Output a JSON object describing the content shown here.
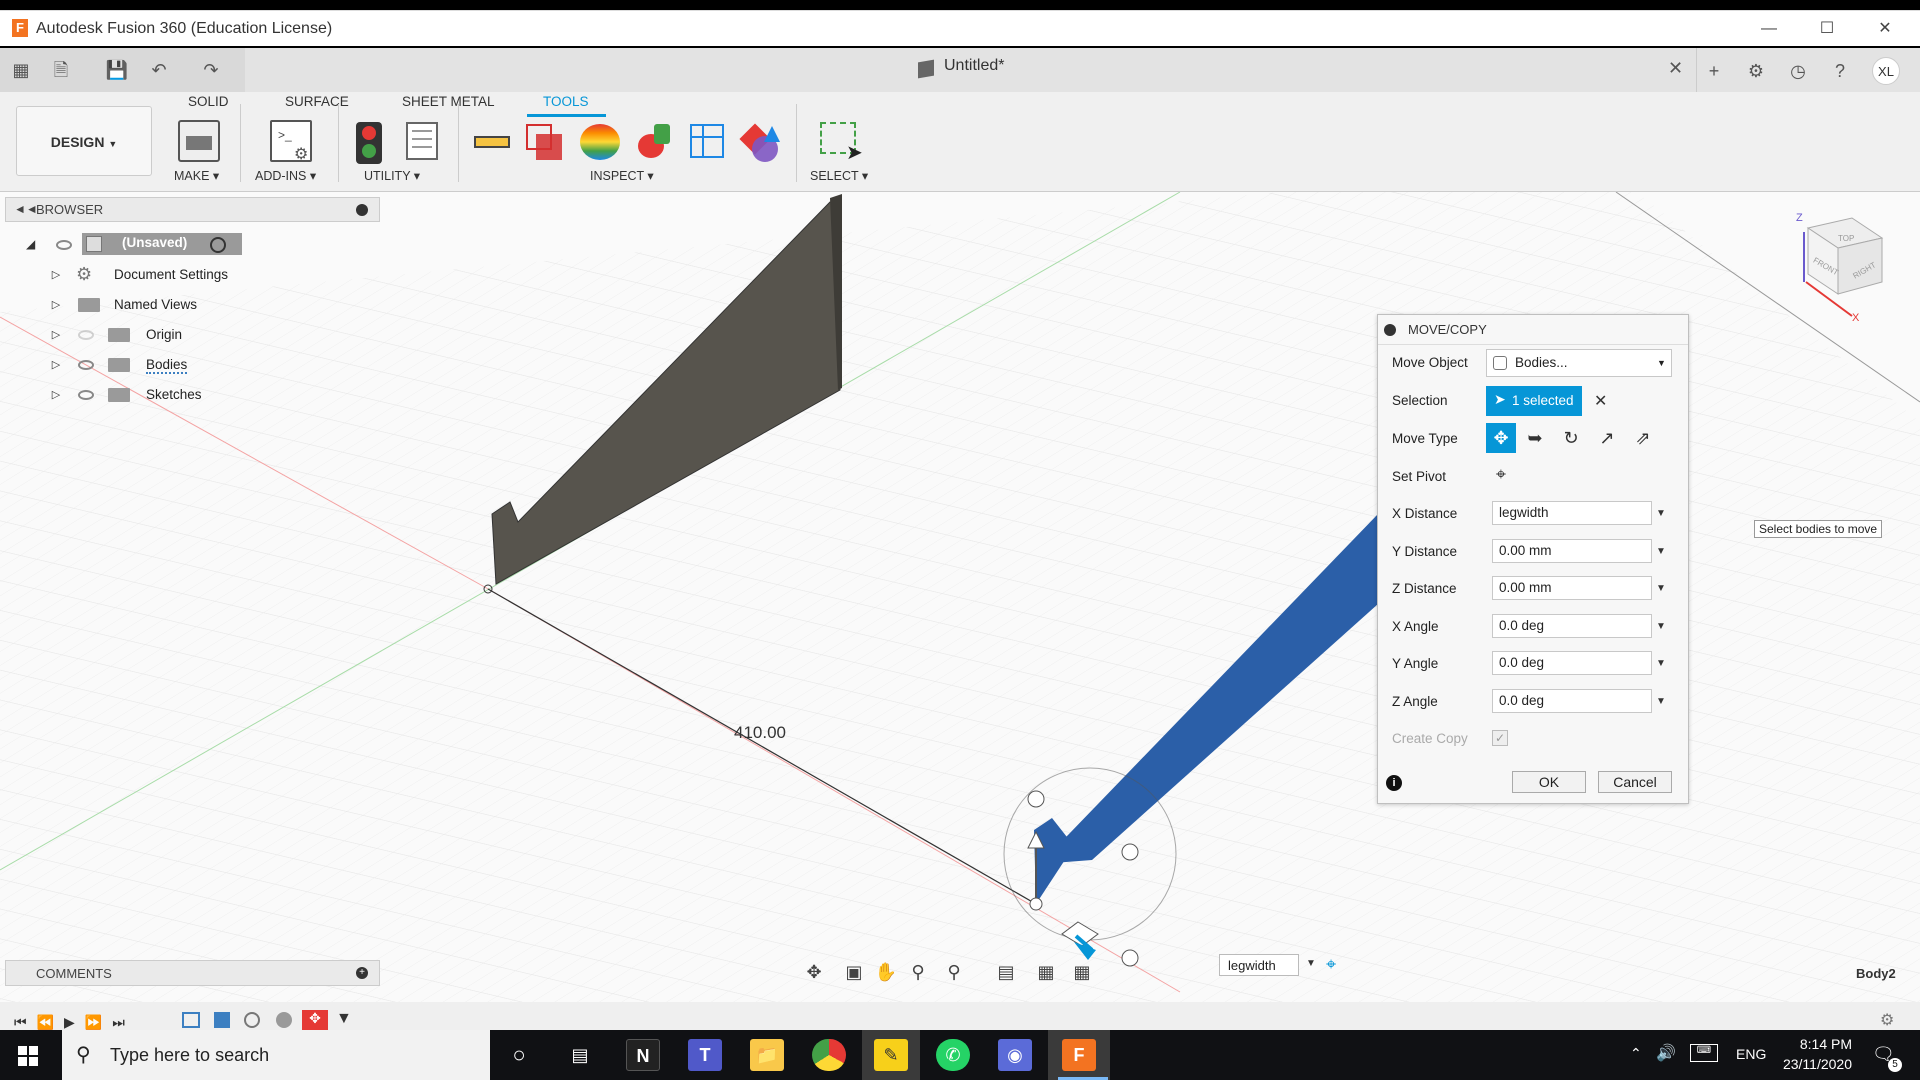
{
  "window": {
    "title": "Autodesk Fusion 360 (Education License)",
    "document_title": "Untitled*",
    "user_initials": "XL"
  },
  "ribbon": {
    "tabs": [
      "SOLID",
      "SURFACE",
      "SHEET METAL",
      "TOOLS"
    ],
    "active_tab": "TOOLS",
    "workspace": "DESIGN",
    "groups": {
      "make": "MAKE",
      "addins": "ADD-INS",
      "utility": "UTILITY",
      "inspect": "INSPECT",
      "select": "SELECT"
    }
  },
  "browser": {
    "title": "BROWSER",
    "root": "(Unsaved)",
    "items": [
      "Document Settings",
      "Named Views",
      "Origin",
      "Bodies",
      "Sketches"
    ]
  },
  "viewport": {
    "dimension": "410.00",
    "tooltip": "Select bodies to move",
    "body_label": "Body2",
    "inline_input": "legwidth",
    "viewcube_faces": [
      "TOP",
      "FRONT",
      "RIGHT"
    ],
    "axis_labels": [
      "Z",
      "X"
    ]
  },
  "dialog": {
    "title": "MOVE/COPY",
    "move_object_label": "Move Object",
    "move_object_value": "Bodies...",
    "selection_label": "Selection",
    "selection_value": "1 selected",
    "move_type_label": "Move Type",
    "set_pivot_label": "Set Pivot",
    "fields": [
      {
        "label": "X Distance",
        "value": "legwidth"
      },
      {
        "label": "Y Distance",
        "value": "0.00 mm"
      },
      {
        "label": "Z Distance",
        "value": "0.00 mm"
      },
      {
        "label": "X Angle",
        "value": "0.0 deg"
      },
      {
        "label": "Y Angle",
        "value": "0.0 deg"
      },
      {
        "label": "Z Angle",
        "value": "0.0 deg"
      }
    ],
    "create_copy_label": "Create Copy",
    "ok_label": "OK",
    "cancel_label": "Cancel"
  },
  "comments": {
    "title": "COMMENTS"
  },
  "taskbar": {
    "search_placeholder": "Type here to search",
    "language": "ENG",
    "time": "8:14 PM",
    "date": "23/11/2020",
    "notification_count": "5"
  },
  "colors": {
    "accent": "#0696d7",
    "selected_body": "#2b5fa8",
    "body_gray": "#57544d",
    "fusion_orange": "#f37321"
  }
}
